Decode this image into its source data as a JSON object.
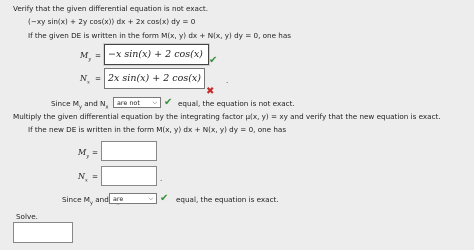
{
  "problem": {
    "prompt": "Verify that the given differential equation is not exact.",
    "equation": "(−xy sin(x) + 2y cos(x)) dx + 2x cos(x) dy = 0"
  },
  "part1": {
    "instruction": "If the given DE is written in the form M(x, y) dx + N(x, y) dy = 0, one has",
    "my_label": "M",
    "my_sub": "y",
    "my_value": "−x sin(x) + 2 cos(x)",
    "nx_label": "N",
    "nx_sub": "x",
    "nx_value": "2x sin(x) + 2 cos(x)",
    "since_text_a": "Since M",
    "since_sub_a": "y",
    "since_text_b": "and N",
    "since_sub_b": "x",
    "dropdown_value": "are not",
    "conclusion": "equal, the equation is not exact."
  },
  "part2": {
    "instruction": "Multiply the given differential equation by the integrating factor μ(x, y) = xy and verify that the new equation is exact.",
    "instruction2": "If the new DE is written in the form M(x, y) dx + N(x, y) dy = 0, one has",
    "my_label": "M",
    "my_sub": "y",
    "nx_label": "N",
    "nx_sub": "x",
    "since_text_a": "Since M",
    "since_sub_a": "y",
    "since_text_b": "and N",
    "since_sub_b": "x",
    "dropdown_value": "are",
    "conclusion": "equal, the equation is exact."
  },
  "solve": {
    "label": "Solve."
  },
  "icons": {
    "check": "✔",
    "cross": "✖",
    "chevron": "⌵",
    "equals": "=",
    "period": "."
  }
}
